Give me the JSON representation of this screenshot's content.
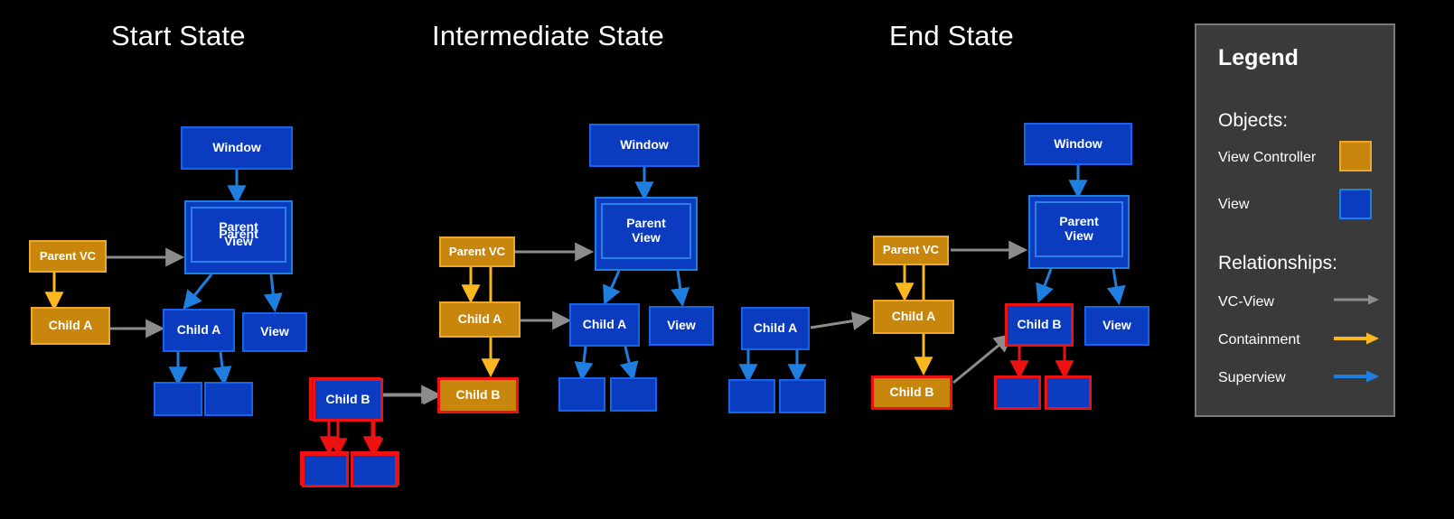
{
  "columns": [
    {
      "title": "Start State"
    },
    {
      "title": "Intermediate State"
    },
    {
      "title": "End State"
    }
  ],
  "labels": {
    "window": "Window",
    "parent_view": "Parent View",
    "parent_view_l1": "Parent",
    "parent_view_l2": "View",
    "parent_vc": "Parent VC",
    "child_a": "Child A",
    "child_b": "Child B",
    "view": "View",
    "empty": ""
  },
  "legend": {
    "title": "Legend",
    "objects_heading": "Objects:",
    "objects": [
      {
        "label": "View Controller",
        "swatch": "view-controller-swatch",
        "color": "#C8860D"
      },
      {
        "label": "View",
        "swatch": "view-swatch",
        "color": "#0B3CBF"
      }
    ],
    "relationships_heading": "Relationships:",
    "relationships": [
      {
        "label": "VC-View",
        "arrow": "gray-arrow",
        "color": "#8C8C8C"
      },
      {
        "label": "Containment",
        "arrow": "amber-arrow",
        "color": "#FAB81E"
      },
      {
        "label": "Superview",
        "arrow": "blue-arrow",
        "color": "#1E7FE0"
      }
    ]
  },
  "colors": {
    "background": "#000000",
    "view_fill": "#0B3CBF",
    "view_border": "#1565E8",
    "vc_fill": "#C8860D",
    "vc_border": "#EFA82E",
    "highlight_border": "#EE1111",
    "vc_view_arrow": "#8C8C8C",
    "containment_arrow": "#FAB81E",
    "superview_arrow": "#1E7FE0",
    "highlight_arrow": "#EE1111",
    "legend_panel": "#3A3A3A",
    "legend_border": "#7A7A7A",
    "text": "#FFFFFF"
  }
}
